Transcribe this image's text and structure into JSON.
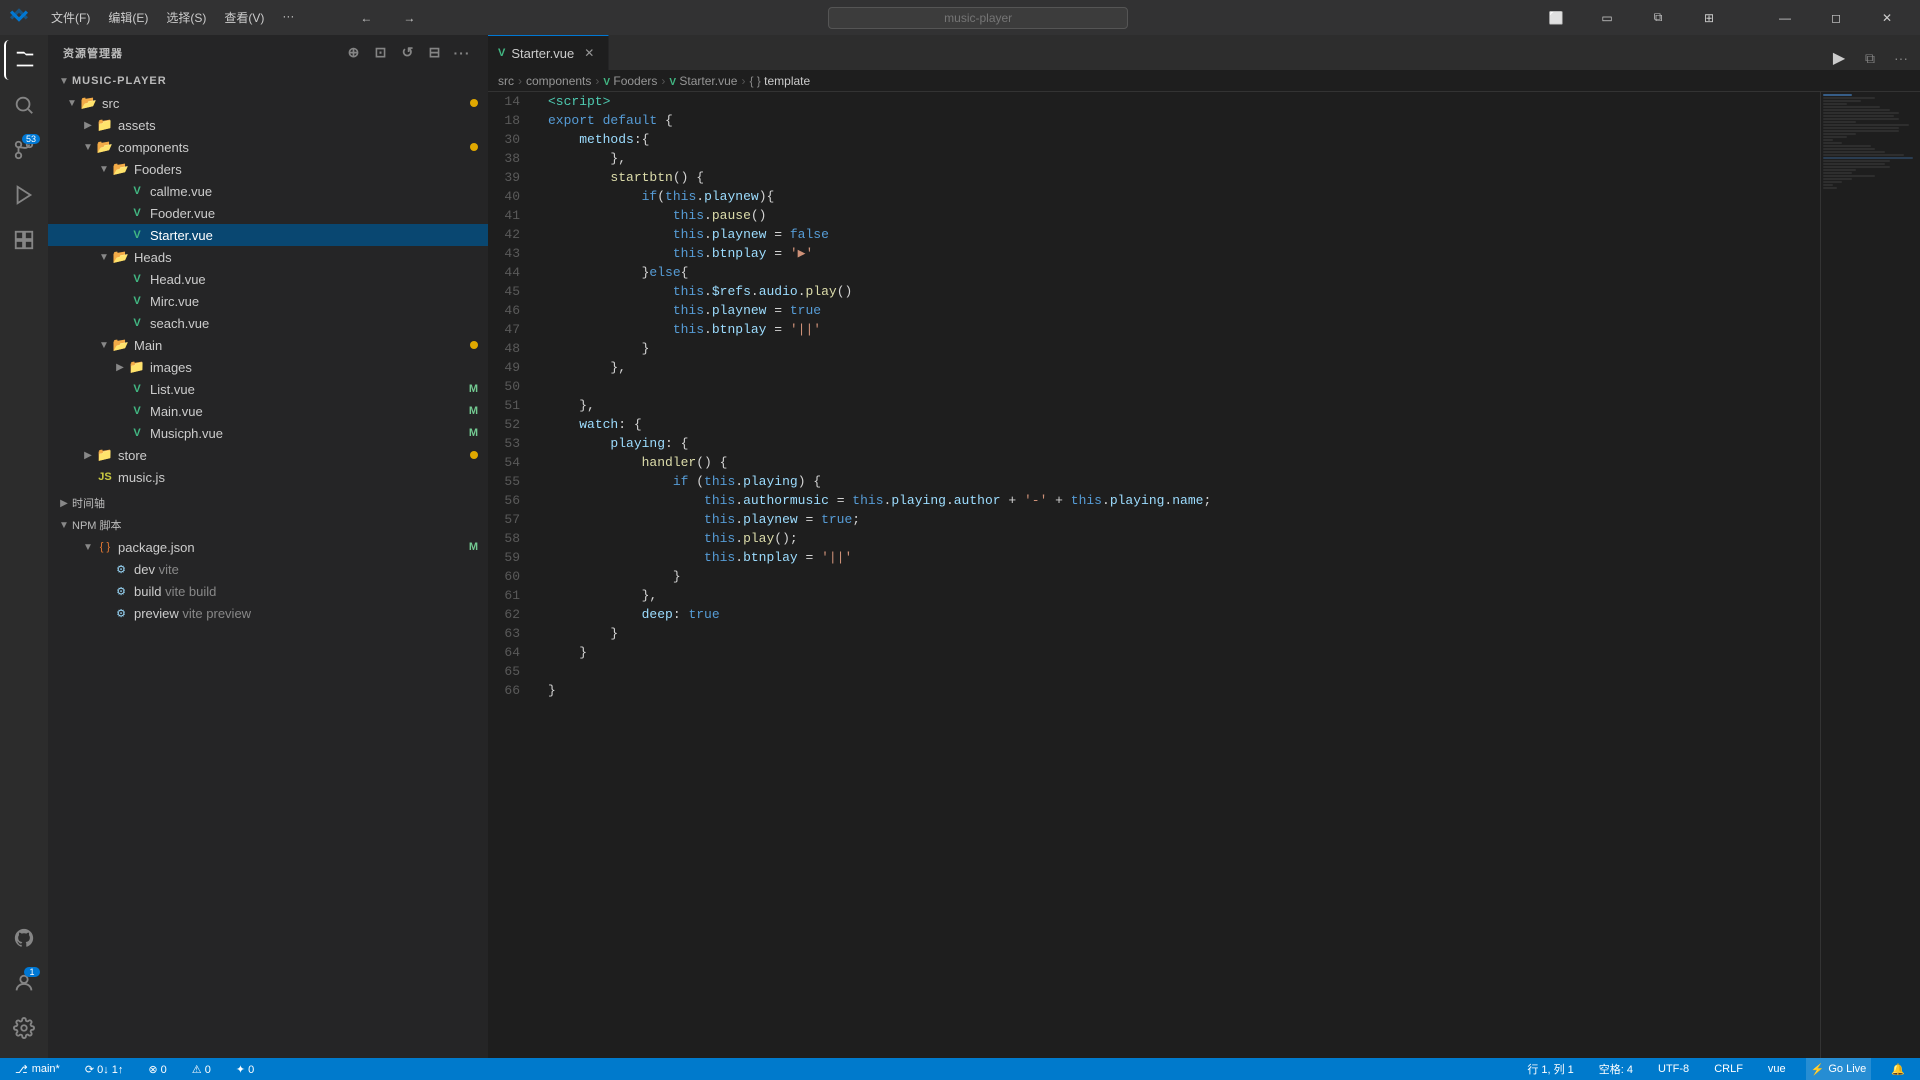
{
  "titlebar": {
    "logo": "VS",
    "menus": [
      "文件(F)",
      "编辑(E)",
      "选择(S)",
      "查看(V)",
      "···"
    ],
    "search_placeholder": "music-player",
    "nav_back": "←",
    "nav_fwd": "→"
  },
  "activity_bar": {
    "icons": [
      {
        "name": "explorer-icon",
        "symbol": "⎘",
        "active": true
      },
      {
        "name": "search-icon",
        "symbol": "⌕",
        "active": false
      },
      {
        "name": "source-control-icon",
        "symbol": "⑂",
        "active": false,
        "badge": "53"
      },
      {
        "name": "run-debug-icon",
        "symbol": "▷",
        "active": false
      },
      {
        "name": "extensions-icon",
        "symbol": "⊞",
        "active": false
      }
    ],
    "bottom_icons": [
      {
        "name": "github-icon",
        "symbol": "⬡"
      },
      {
        "name": "accounts-icon",
        "symbol": "◉",
        "badge": "1"
      },
      {
        "name": "settings-icon",
        "symbol": "⚙"
      }
    ]
  },
  "sidebar": {
    "title": "资源管理器",
    "project_name": "MUSIC-PLAYER",
    "tree": {
      "src": {
        "label": "src",
        "modified": true,
        "children": {
          "assets": {
            "label": "assets"
          },
          "components": {
            "label": "components",
            "modified": true,
            "children": {
              "Fooders": {
                "label": "Fooders",
                "children": {
                  "callme": {
                    "label": "callme.vue",
                    "type": "vue"
                  },
                  "Fooder": {
                    "label": "Fooder.vue",
                    "type": "vue"
                  },
                  "Starter": {
                    "label": "Starter.vue",
                    "type": "vue",
                    "selected": true
                  }
                }
              },
              "Heads": {
                "label": "Heads",
                "children": {
                  "Head": {
                    "label": "Head.vue",
                    "type": "vue"
                  },
                  "Mirc": {
                    "label": "Mirc.vue",
                    "type": "vue"
                  },
                  "seach": {
                    "label": "seach.vue",
                    "type": "vue"
                  }
                }
              },
              "Main": {
                "label": "Main",
                "modified": true,
                "children": {
                  "images": {
                    "label": "images"
                  },
                  "List": {
                    "label": "List.vue",
                    "type": "vue",
                    "letter": "M"
                  },
                  "Main_vue": {
                    "label": "Main.vue",
                    "type": "vue",
                    "letter": "M"
                  },
                  "Musicph": {
                    "label": "Musicph.vue",
                    "type": "vue",
                    "letter": "M"
                  }
                }
              },
              "store": {
                "label": "store",
                "modified": true
              },
              "music_js": {
                "label": "music.js",
                "type": "js"
              }
            }
          }
        }
      },
      "timeline": {
        "label": "时间轴"
      },
      "npm_scripts": {
        "label": "NPM 脚本",
        "children": {
          "package_json": {
            "label": "package.json",
            "letter": "M",
            "scripts": [
              {
                "name": "dev",
                "cmd": "vite"
              },
              {
                "name": "build",
                "cmd": "vite build"
              },
              {
                "name": "preview",
                "cmd": "vite preview"
              }
            ]
          }
        }
      }
    }
  },
  "editor": {
    "tab_label": "Starter.vue",
    "breadcrumb": [
      "src",
      "components",
      "Fooders",
      "Starter.vue",
      "template"
    ],
    "run_label": "▶",
    "lines": [
      {
        "num": 14,
        "code": "<script>",
        "tokens": [
          {
            "t": "tag",
            "v": "<script>"
          }
        ]
      },
      {
        "num": 18,
        "code": "export default {",
        "tokens": [
          {
            "t": "kw",
            "v": "export"
          },
          {
            "t": "plain",
            "v": " "
          },
          {
            "t": "kw",
            "v": "default"
          },
          {
            "t": "plain",
            "v": " {"
          }
        ]
      },
      {
        "num": 30,
        "code": "    methods:{",
        "tokens": [
          {
            "t": "plain",
            "v": "    "
          },
          {
            "t": "prop",
            "v": "methods"
          },
          {
            "t": "plain",
            "v": ":{"
          }
        ]
      },
      {
        "num": 38,
        "code": "        },",
        "tokens": [
          {
            "t": "plain",
            "v": "        },"
          }
        ]
      },
      {
        "num": 39,
        "code": "        startbtn() {",
        "tokens": [
          {
            "t": "plain",
            "v": "        "
          },
          {
            "t": "fn",
            "v": "startbtn"
          },
          {
            "t": "plain",
            "v": "() {"
          }
        ]
      },
      {
        "num": 40,
        "code": "            if(this.playnew){",
        "tokens": [
          {
            "t": "plain",
            "v": "            "
          },
          {
            "t": "kw",
            "v": "if"
          },
          {
            "t": "plain",
            "v": "("
          },
          {
            "t": "kw",
            "v": "this"
          },
          {
            "t": "plain",
            "v": "."
          },
          {
            "t": "prop",
            "v": "playnew"
          },
          {
            "t": "plain",
            "v": "){"
          }
        ]
      },
      {
        "num": 41,
        "code": "                this.pause()",
        "tokens": [
          {
            "t": "plain",
            "v": "                "
          },
          {
            "t": "kw",
            "v": "this"
          },
          {
            "t": "plain",
            "v": "."
          },
          {
            "t": "fn",
            "v": "pause"
          },
          {
            "t": "plain",
            "v": "()"
          }
        ]
      },
      {
        "num": 42,
        "code": "                this.playnew = false",
        "tokens": [
          {
            "t": "plain",
            "v": "                "
          },
          {
            "t": "kw",
            "v": "this"
          },
          {
            "t": "plain",
            "v": "."
          },
          {
            "t": "prop",
            "v": "playnew"
          },
          {
            "t": "plain",
            "v": " = "
          },
          {
            "t": "bool",
            "v": "false"
          }
        ]
      },
      {
        "num": 43,
        "code": "                this.btnplay = '▶'",
        "tokens": [
          {
            "t": "plain",
            "v": "                "
          },
          {
            "t": "kw",
            "v": "this"
          },
          {
            "t": "plain",
            "v": "."
          },
          {
            "t": "prop",
            "v": "btnplay"
          },
          {
            "t": "plain",
            "v": " = "
          },
          {
            "t": "str",
            "v": "'▶'"
          }
        ]
      },
      {
        "num": 44,
        "code": "            }else{",
        "tokens": [
          {
            "t": "plain",
            "v": "            "
          },
          {
            "t": "plain",
            "v": "}"
          },
          {
            "t": "kw",
            "v": "else"
          },
          {
            "t": "plain",
            "v": "{"
          }
        ]
      },
      {
        "num": 45,
        "code": "                this.$refs.audio.play()",
        "tokens": [
          {
            "t": "plain",
            "v": "                "
          },
          {
            "t": "kw",
            "v": "this"
          },
          {
            "t": "plain",
            "v": "."
          },
          {
            "t": "prop",
            "v": "$refs"
          },
          {
            "t": "plain",
            "v": "."
          },
          {
            "t": "prop",
            "v": "audio"
          },
          {
            "t": "plain",
            "v": "."
          },
          {
            "t": "fn",
            "v": "play"
          },
          {
            "t": "plain",
            "v": "()"
          }
        ]
      },
      {
        "num": 46,
        "code": "                this.playnew = true",
        "tokens": [
          {
            "t": "plain",
            "v": "                "
          },
          {
            "t": "kw",
            "v": "this"
          },
          {
            "t": "plain",
            "v": "."
          },
          {
            "t": "prop",
            "v": "playnew"
          },
          {
            "t": "plain",
            "v": " = "
          },
          {
            "t": "bool",
            "v": "true"
          }
        ]
      },
      {
        "num": 47,
        "code": "                this.btnplay = '||'",
        "tokens": [
          {
            "t": "plain",
            "v": "                "
          },
          {
            "t": "kw",
            "v": "this"
          },
          {
            "t": "plain",
            "v": "."
          },
          {
            "t": "prop",
            "v": "btnplay"
          },
          {
            "t": "plain",
            "v": " = "
          },
          {
            "t": "str",
            "v": "'||'"
          }
        ]
      },
      {
        "num": 48,
        "code": "            }",
        "tokens": [
          {
            "t": "plain",
            "v": "            }"
          }
        ]
      },
      {
        "num": 49,
        "code": "        },",
        "tokens": [
          {
            "t": "plain",
            "v": "        },"
          }
        ]
      },
      {
        "num": 50,
        "code": "",
        "tokens": []
      },
      {
        "num": 51,
        "code": "    },",
        "tokens": [
          {
            "t": "plain",
            "v": "    },"
          }
        ]
      },
      {
        "num": 52,
        "code": "    watch: {",
        "tokens": [
          {
            "t": "plain",
            "v": "    "
          },
          {
            "t": "prop",
            "v": "watch"
          },
          {
            "t": "plain",
            "v": ": {"
          }
        ]
      },
      {
        "num": 53,
        "code": "        playing: {",
        "tokens": [
          {
            "t": "plain",
            "v": "        "
          },
          {
            "t": "prop",
            "v": "playing"
          },
          {
            "t": "plain",
            "v": ": {"
          }
        ]
      },
      {
        "num": 54,
        "code": "            handler() {",
        "tokens": [
          {
            "t": "plain",
            "v": "            "
          },
          {
            "t": "fn",
            "v": "handler"
          },
          {
            "t": "plain",
            "v": "() {"
          }
        ]
      },
      {
        "num": 55,
        "code": "                if (this.playing) {",
        "tokens": [
          {
            "t": "plain",
            "v": "                "
          },
          {
            "t": "kw",
            "v": "if"
          },
          {
            "t": "plain",
            "v": " ("
          },
          {
            "t": "kw",
            "v": "this"
          },
          {
            "t": "plain",
            "v": "."
          },
          {
            "t": "prop",
            "v": "playing"
          },
          {
            "t": "plain",
            "v": ") {"
          }
        ]
      },
      {
        "num": 56,
        "code": "                    this.authormusic = this.playing.author + '-' + this.playing.name;",
        "tokens": [
          {
            "t": "plain",
            "v": "                    "
          },
          {
            "t": "kw",
            "v": "this"
          },
          {
            "t": "plain",
            "v": "."
          },
          {
            "t": "prop",
            "v": "authormusic"
          },
          {
            "t": "plain",
            "v": " = "
          },
          {
            "t": "kw",
            "v": "this"
          },
          {
            "t": "plain",
            "v": "."
          },
          {
            "t": "prop",
            "v": "playing"
          },
          {
            "t": "plain",
            "v": "."
          },
          {
            "t": "prop",
            "v": "author"
          },
          {
            "t": "plain",
            "v": " + "
          },
          {
            "t": "str",
            "v": "'-'"
          },
          {
            "t": "plain",
            "v": " + "
          },
          {
            "t": "kw",
            "v": "this"
          },
          {
            "t": "plain",
            "v": "."
          },
          {
            "t": "prop",
            "v": "playing"
          },
          {
            "t": "plain",
            "v": "."
          },
          {
            "t": "prop",
            "v": "name"
          },
          {
            "t": "plain",
            "v": ";"
          }
        ]
      },
      {
        "num": 57,
        "code": "                    this.playnew = true;",
        "tokens": [
          {
            "t": "plain",
            "v": "                    "
          },
          {
            "t": "kw",
            "v": "this"
          },
          {
            "t": "plain",
            "v": "."
          },
          {
            "t": "prop",
            "v": "playnew"
          },
          {
            "t": "plain",
            "v": " = "
          },
          {
            "t": "bool",
            "v": "true"
          },
          {
            "t": "plain",
            "v": ";"
          }
        ]
      },
      {
        "num": 58,
        "code": "                    this.play();",
        "tokens": [
          {
            "t": "plain",
            "v": "                    "
          },
          {
            "t": "kw",
            "v": "this"
          },
          {
            "t": "plain",
            "v": "."
          },
          {
            "t": "fn",
            "v": "play"
          },
          {
            "t": "plain",
            "v": "();"
          }
        ]
      },
      {
        "num": 59,
        "code": "                    this.btnplay = '||'",
        "tokens": [
          {
            "t": "plain",
            "v": "                    "
          },
          {
            "t": "kw",
            "v": "this"
          },
          {
            "t": "plain",
            "v": "."
          },
          {
            "t": "prop",
            "v": "btnplay"
          },
          {
            "t": "plain",
            "v": " = "
          },
          {
            "t": "str",
            "v": "'||'"
          }
        ]
      },
      {
        "num": 60,
        "code": "                }",
        "tokens": [
          {
            "t": "plain",
            "v": "                }"
          }
        ]
      },
      {
        "num": 61,
        "code": "            },",
        "tokens": [
          {
            "t": "plain",
            "v": "            },"
          }
        ]
      },
      {
        "num": 62,
        "code": "            deep: true",
        "tokens": [
          {
            "t": "plain",
            "v": "            "
          },
          {
            "t": "prop",
            "v": "deep"
          },
          {
            "t": "plain",
            "v": ": "
          },
          {
            "t": "bool",
            "v": "true"
          }
        ]
      },
      {
        "num": 63,
        "code": "        }",
        "tokens": [
          {
            "t": "plain",
            "v": "        }"
          }
        ]
      },
      {
        "num": 64,
        "code": "    }",
        "tokens": [
          {
            "t": "plain",
            "v": "    }"
          }
        ]
      },
      {
        "num": 65,
        "code": "",
        "tokens": []
      },
      {
        "num": 66,
        "code": "}",
        "tokens": [
          {
            "t": "plain",
            "v": "}"
          }
        ]
      }
    ]
  },
  "statusbar": {
    "branch": "main*",
    "sync": "⟳ 0↓ 1↑",
    "errors": "⊗ 0",
    "warnings": "⚠ 0",
    "problems": "✦ 0",
    "position": "行 1, 列 1",
    "spaces": "空格: 4",
    "encoding": "UTF-8",
    "line_ending": "CRLF",
    "language": "vue",
    "go_live": "Go Live"
  }
}
